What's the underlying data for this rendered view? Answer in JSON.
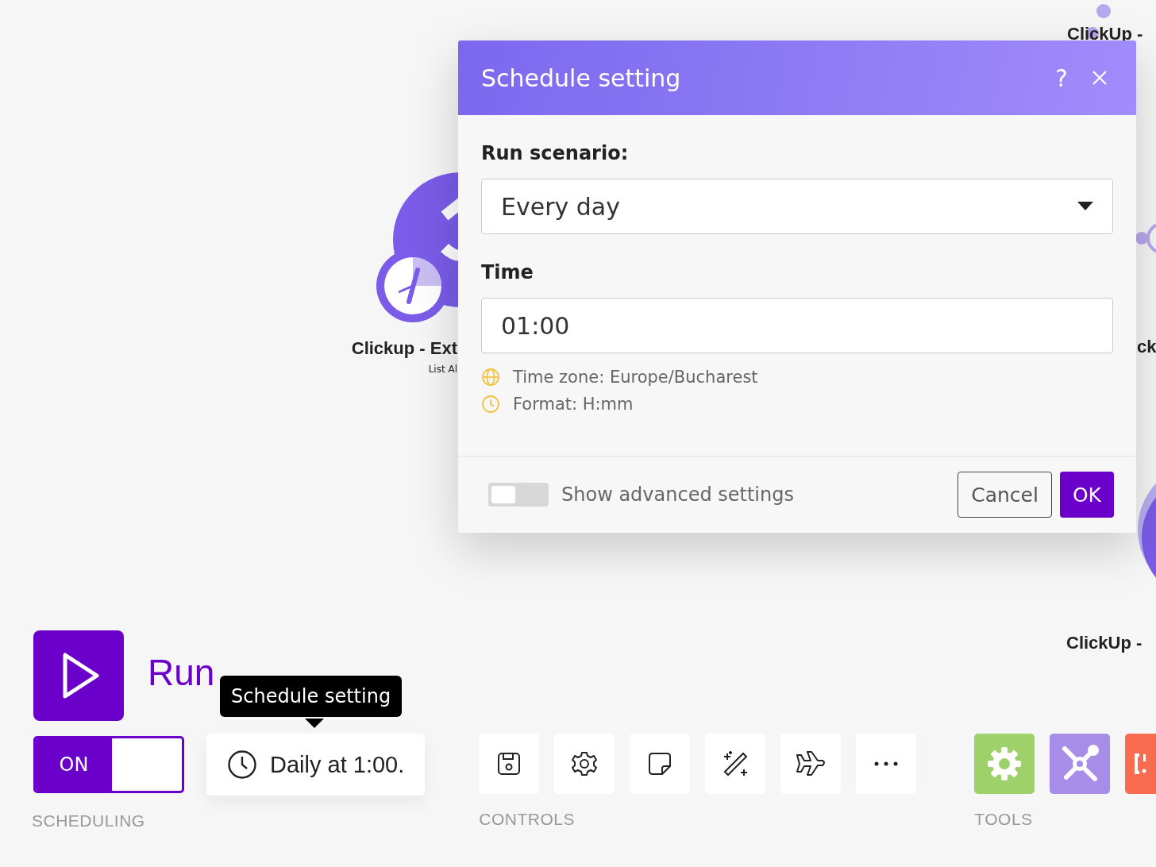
{
  "canvas": {
    "nodes": [
      {
        "kind": "top",
        "title": "ClickUp -"
      },
      {
        "kind": "trigger",
        "title": "Clickup - Ext",
        "subtitle": "List Al"
      },
      {
        "kind": "edge",
        "title": "ck"
      },
      {
        "kind": "bottom",
        "title": "ClickUp -"
      }
    ]
  },
  "dialog": {
    "title": "Schedule setting",
    "help": "?",
    "run_scenario": {
      "label": "Run scenario:",
      "value": "Every day"
    },
    "time": {
      "label": "Time",
      "value": "01:00"
    },
    "notes": [
      {
        "kind": "timezone",
        "text": "Time zone: Europe/Bucharest"
      },
      {
        "kind": "format",
        "text": "Format: H:mm"
      }
    ],
    "advanced": {
      "label": "Show advanced settings",
      "on": false
    },
    "buttons": {
      "cancel": "Cancel",
      "ok": "OK"
    }
  },
  "toolbar": {
    "run_once": "Run",
    "tooltip": "Schedule setting",
    "scheduling": {
      "switch": {
        "label": "ON",
        "on": true
      },
      "schedule": "Daily at 1:00.",
      "section_label": "SCHEDULING"
    },
    "controls": {
      "items": [
        {
          "kind": "save"
        },
        {
          "kind": "settings"
        },
        {
          "kind": "note"
        },
        {
          "kind": "magic"
        },
        {
          "kind": "plane"
        },
        {
          "kind": "more"
        }
      ],
      "section_label": "CONTROLS"
    },
    "tools": {
      "items": [
        {
          "kind": "gear"
        },
        {
          "kind": "tools"
        },
        {
          "kind": "regex"
        }
      ],
      "section_label": "TOOLS"
    }
  }
}
